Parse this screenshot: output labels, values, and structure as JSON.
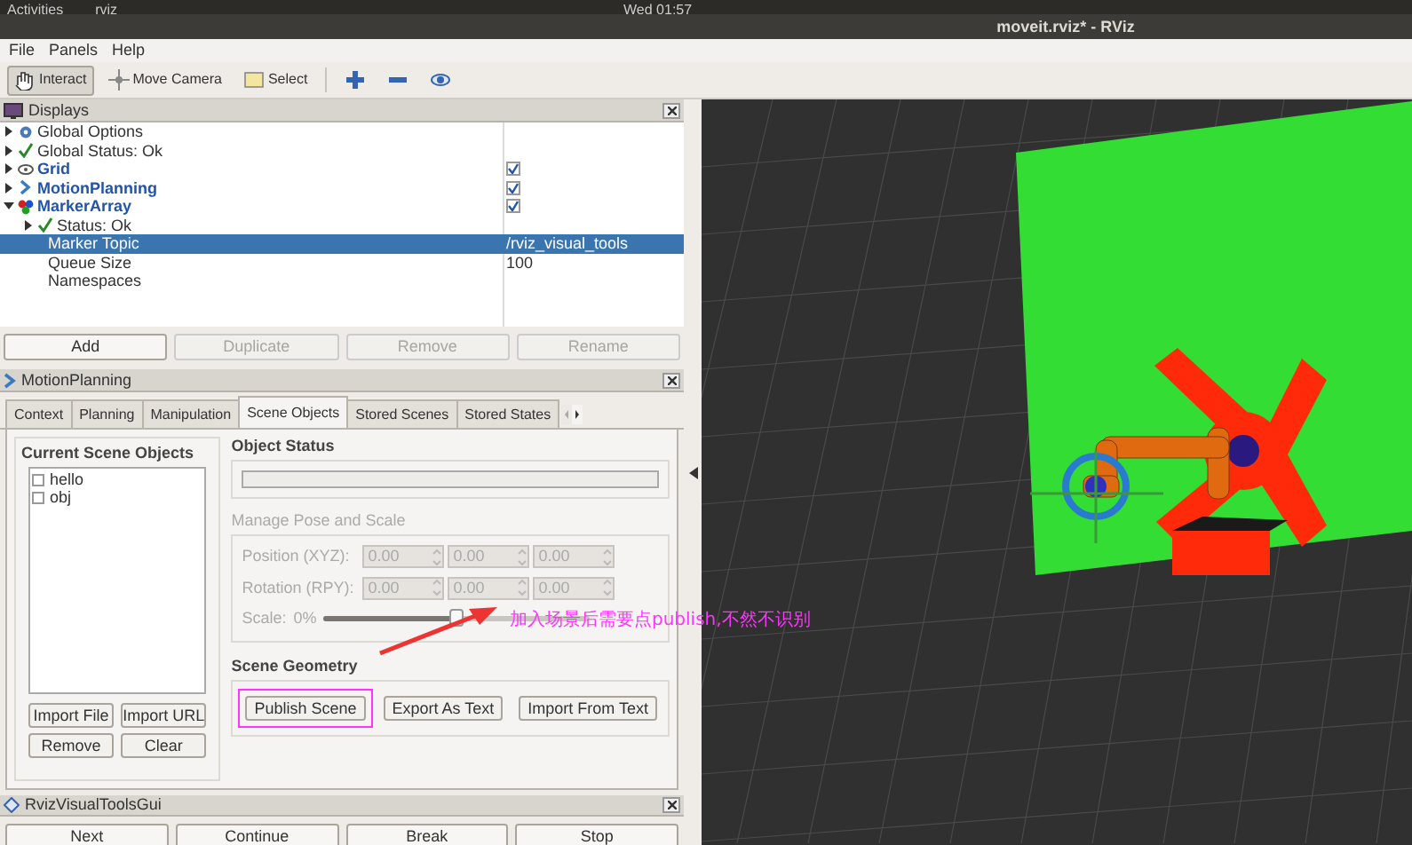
{
  "top_bar": {
    "activities": "Activities",
    "app": "rviz",
    "clock": "Wed 01:57"
  },
  "window": {
    "title": "moveit.rviz* - RViz"
  },
  "menu": [
    "File",
    "Panels",
    "Help"
  ],
  "toolbar": [
    {
      "kind": "interact",
      "label": "Interact",
      "selected": true
    },
    {
      "kind": "camera",
      "label": "Move Camera",
      "selected": false
    },
    {
      "kind": "select",
      "label": "Select",
      "selected": false
    },
    {
      "kind": "plus",
      "selected": false
    },
    {
      "kind": "minus",
      "selected": false
    },
    {
      "kind": "eye",
      "selected": false
    }
  ],
  "displays": {
    "title": "Displays",
    "tree": [
      {
        "kind": "options",
        "label": "Global Options",
        "expanded": false,
        "selected": false
      },
      {
        "kind": "status",
        "label": "Global Status: Ok",
        "expanded": false,
        "selected": false
      },
      {
        "kind": "grid",
        "label": "Grid",
        "expanded": false,
        "checked": true,
        "selected": false
      },
      {
        "kind": "planning",
        "label": "MotionPlanning",
        "expanded": false,
        "checked": true,
        "selected": false
      },
      {
        "kind": "marker",
        "label": "MarkerArray",
        "expanded": true,
        "checked": true,
        "selected": false,
        "children": [
          {
            "kind": "status",
            "label": "Status: Ok",
            "expanded": false,
            "selected": false
          },
          {
            "kind": "property",
            "label": "Marker Topic",
            "value": "/rviz_visual_tools",
            "selected": true
          },
          {
            "kind": "property",
            "label": "Queue Size",
            "value": "100",
            "selected": false
          },
          {
            "kind": "property",
            "label": "Namespaces",
            "selected": false
          }
        ]
      }
    ],
    "buttons": [
      {
        "label": "Add",
        "disabled": false
      },
      {
        "label": "Duplicate",
        "disabled": true
      },
      {
        "label": "Remove",
        "disabled": true
      },
      {
        "label": "Rename",
        "disabled": true
      }
    ]
  },
  "motion_planning": {
    "title": "MotionPlanning",
    "tabs": [
      {
        "label": "Context",
        "selected": false
      },
      {
        "label": "Planning",
        "selected": false
      },
      {
        "label": "Manipulation",
        "selected": false
      },
      {
        "label": "Scene Objects",
        "selected": true
      },
      {
        "label": "Stored Scenes",
        "selected": false
      },
      {
        "label": "Stored States",
        "selected": false
      }
    ],
    "current_scene_objects": {
      "title": "Current Scene Objects",
      "objects": [
        {
          "label": "hello",
          "checked": false
        },
        {
          "label": "obj",
          "checked": false
        }
      ],
      "buttons": [
        "Import File",
        "Import URL",
        "Remove",
        "Clear"
      ]
    },
    "object_status": {
      "title": "Object Status",
      "level": 0
    },
    "manage_pose": {
      "title": "Manage Pose and Scale",
      "disabled": true,
      "rows": [
        {
          "label": "Position (XYZ):",
          "values": [
            "0.00",
            "0.00",
            "0.00"
          ]
        },
        {
          "label": "Rotation (RPY):",
          "values": [
            "0.00",
            "0.00",
            "0.00"
          ]
        }
      ],
      "scale": {
        "label": "Scale:",
        "min": "0%",
        "level": 0.5
      }
    },
    "scene_geometry": {
      "title": "Scene Geometry",
      "buttons": [
        {
          "label": "Publish Scene",
          "highlighted": true
        },
        {
          "label": "Export As Text",
          "highlighted": false
        },
        {
          "label": "Import From Text",
          "highlighted": false
        }
      ]
    },
    "annotation": {
      "text": "加入场景后需要点publish,不然不识别"
    }
  },
  "rviz_visual_tools": {
    "title": "RvizVisualToolsGui",
    "buttons": [
      "Next",
      "Continue",
      "Break",
      "Stop"
    ]
  }
}
